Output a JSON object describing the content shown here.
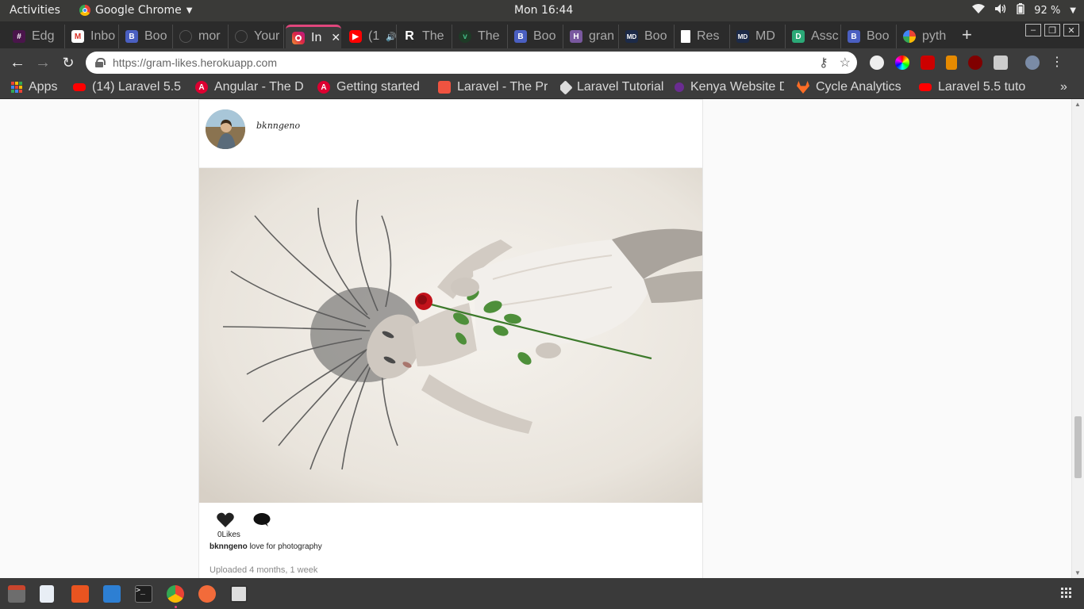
{
  "system": {
    "activities": "Activities",
    "app_name": "Google Chrome",
    "clock": "Mon 16:44",
    "battery": "92 %"
  },
  "tabs": [
    {
      "label": "Edg",
      "icon": "slack-icon",
      "color": "#4a154b"
    },
    {
      "label": "Inbo",
      "icon": "gmail-icon",
      "color": "#d93025"
    },
    {
      "label": "Boo",
      "icon": "bootstrap-icon",
      "color": "#4a5fc1"
    },
    {
      "label": "mor",
      "icon": "github-icon",
      "color": "#222222"
    },
    {
      "label": "Your",
      "icon": "github-icon",
      "color": "#222222"
    },
    {
      "label": "In",
      "icon": "instagram-icon",
      "color": "#c13584",
      "active": true
    },
    {
      "label": "(1",
      "icon": "youtube-icon",
      "color": "#ff0000"
    },
    {
      "label": "The",
      "icon": "r-icon",
      "color": "#5c2d91"
    },
    {
      "label": "The",
      "icon": "vue-icon",
      "color": "#2b5b36"
    },
    {
      "label": "Boo",
      "icon": "bootstrap-icon",
      "color": "#4a5fc1"
    },
    {
      "label": "gran",
      "icon": "heroku-icon",
      "color": "#79589f"
    },
    {
      "label": "Boo",
      "icon": "mdb-icon",
      "color": "#1c2a48"
    },
    {
      "label": "Res",
      "icon": "document-icon",
      "color": "#ffffff"
    },
    {
      "label": "MD",
      "icon": "mdb-icon",
      "color": "#1c2a48"
    },
    {
      "label": "Assc",
      "icon": "django-icon",
      "color": "#2ba977"
    },
    {
      "label": "Boo",
      "icon": "bootstrap-icon",
      "color": "#4a5fc1"
    },
    {
      "label": "pyth",
      "icon": "google-icon",
      "color": "#4285f4"
    }
  ],
  "omnibox": {
    "url": "https://gram-likes.herokuapp.com"
  },
  "bookmarks": [
    {
      "label": "Apps",
      "icon": "apps-grid-icon",
      "color": "#e94235"
    },
    {
      "label": "(14) Laravel 5.5",
      "icon": "youtube-icon",
      "color": "#ff0000"
    },
    {
      "label": "Angular - The D",
      "icon": "angular-icon",
      "color": "#dd0031"
    },
    {
      "label": "Getting started",
      "icon": "angular-icon",
      "color": "#dd0031"
    },
    {
      "label": "Laravel - The Pr",
      "icon": "laravel-icon",
      "color": "#f05340"
    },
    {
      "label": "Laravel Tutorial",
      "icon": "tutorial-icon",
      "color": "#dddddd"
    },
    {
      "label": "Kenya Website D",
      "icon": "site-icon",
      "color": "#6a2c91"
    },
    {
      "label": "Cycle Analytics",
      "icon": "gitlab-icon",
      "color": "#fc6d26"
    },
    {
      "label": "Laravel 5.5 tuto",
      "icon": "youtube-icon",
      "color": "#ff0000"
    }
  ],
  "post": {
    "username_script": "bknngeno",
    "likes": "0Likes",
    "caption_user": "bknngeno",
    "caption_text": "love for photography",
    "uploaded": "Uploaded 4 months, 1 week"
  },
  "colors": {
    "accent": "#e0467c",
    "topbar": "#3a3a38",
    "chrome_dark": "#3c3c3c"
  }
}
